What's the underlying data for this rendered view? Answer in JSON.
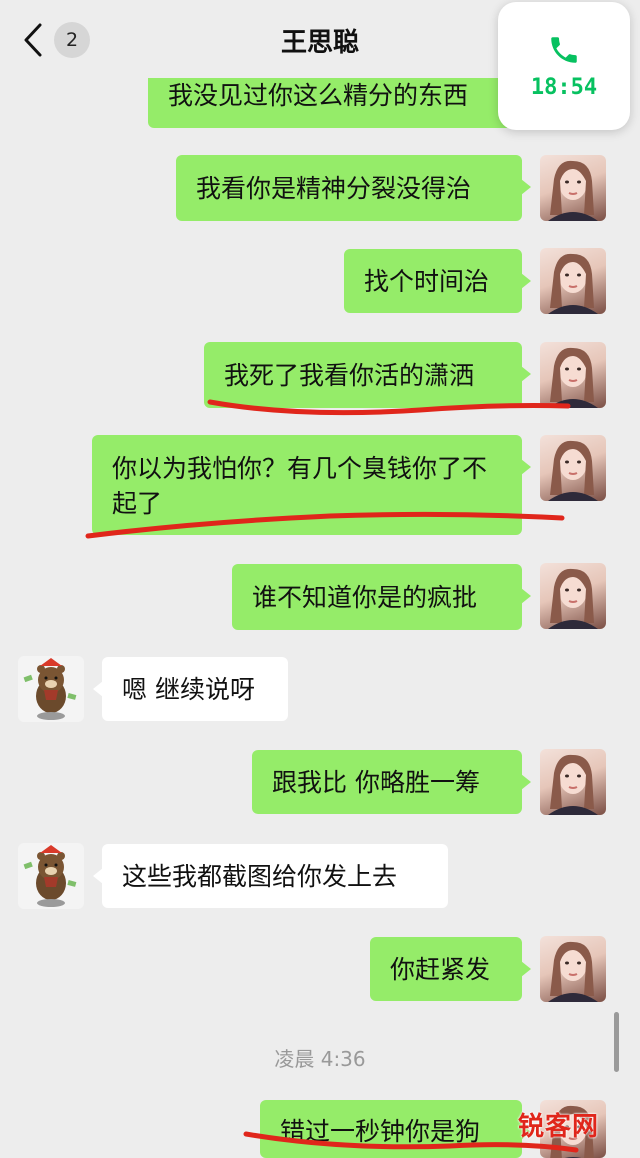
{
  "header": {
    "title": "王思聪",
    "unread_count": "2",
    "back_icon": "chevron-left-icon"
  },
  "call_widget": {
    "icon": "phone-icon",
    "time": "18:54",
    "color": "#07c160"
  },
  "messages": [
    {
      "side": "me",
      "text": "我没见过你这么精分的东西"
    },
    {
      "side": "me",
      "text": "我看你是精神分裂没得治"
    },
    {
      "side": "me",
      "text": "找个时间治"
    },
    {
      "side": "me",
      "text": "我死了我看你活的潇洒"
    },
    {
      "side": "me",
      "text": "你以为我怕你？有几个臭钱你了不起了"
    },
    {
      "side": "me",
      "text": "谁不知道你是的疯批"
    },
    {
      "side": "other",
      "text": "嗯 继续说呀"
    },
    {
      "side": "me",
      "text": "跟我比 你略胜一筹"
    },
    {
      "side": "other",
      "text": "这些我都截图给你发上去"
    },
    {
      "side": "me",
      "text": "你赶紧发"
    },
    {
      "side": "me",
      "text": "错过一秒钟你是狗"
    }
  ],
  "timestamp": "凌晨 4:36",
  "watermark": "锐客网",
  "colors": {
    "background": "#ededed",
    "my_bubble": "#95ec69",
    "other_bubble": "#ffffff",
    "annotation": "#e0261b"
  }
}
